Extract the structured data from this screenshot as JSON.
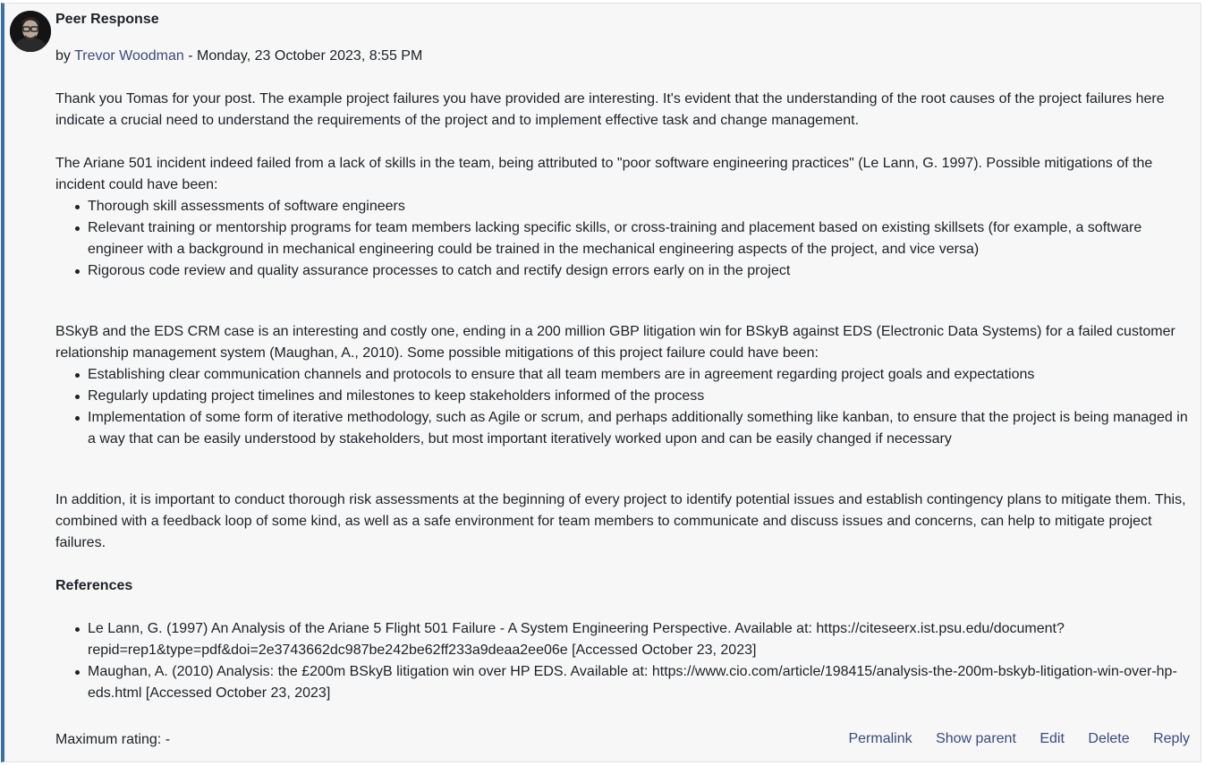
{
  "post": {
    "subject": "Peer Response",
    "byline_prefix": "by ",
    "author": "Trevor Woodman",
    "byline_sep": " - ",
    "date": "Monday, 23 October 2023, 8:55 PM",
    "intro": "Thank you Tomas for your post. The example project failures you have provided are interesting. It's evident that the understanding of the root causes of the project failures here indicate a crucial need to understand the requirements of the project and to implement effective task and change management.",
    "ariane_intro": "The Ariane 501 incident indeed failed from a lack of skills in the team, being attributed to \"poor software engineering practices\" (Le Lann, G. 1997). Possible mitigations of the incident could have been:",
    "ariane_items": [
      "Thorough skill assessments of software engineers",
      "Relevant training or mentorship programs for team members lacking specific skills, or cross-training and placement based on existing skillsets (for example, a software engineer with a background in mechanical engineering could be trained in the mechanical engineering aspects of the project, and vice versa)",
      "Rigorous code review and quality assurance processes to catch and rectify design errors early on in the project"
    ],
    "bskyb_intro": "BSkyB and the EDS CRM case is an interesting and costly one, ending in a 200 million GBP litigation win for BSkyB against EDS (Electronic Data Systems) for a failed customer relationship management system (Maughan, A., 2010). Some possible mitigations of this project failure could have been:",
    "bskyb_items": [
      "Establishing clear communication channels and protocols to ensure that all team members are in agreement regarding project goals and expectations",
      "Regularly updating project timelines and milestones to keep stakeholders informed of the process",
      "Implementation of some form of iterative methodology, such as Agile or scrum, and perhaps additionally something like kanban, to ensure that the project is being managed in a way that can be easily understood by stakeholders, but most important iteratively worked upon and can be easily changed if necessary"
    ],
    "conclusion": "In addition, it is important to conduct thorough risk assessments at the beginning of every project to identify potential issues and establish contingency plans to mitigate them. This, combined with a feedback loop of some kind, as well as a safe environment for team members to communicate and discuss issues and concerns, can help to mitigate project failures.",
    "references_title": "References",
    "references": [
      "Le Lann, G. (1997) An Analysis of the Ariane 5 Flight 501 Failure - A System Engineering Perspective. Available at: https://citeseerx.ist.psu.edu/document?repid=rep1&type=pdf&doi=2e3743662dc987be242be62ff233a9deaa2ee06e [Accessed October 23, 2023]",
      "Maughan, A. (2010) Analysis: the £200m BSkyB litigation win over HP EDS. Available at: https://www.cio.com/article/198415/analysis-the-200m-bskyb-litigation-win-over-hp-eds.html [Accessed October 23, 2023]"
    ]
  },
  "footer": {
    "rating": "Maximum rating: -",
    "actions": [
      "Permalink",
      "Show parent",
      "Edit",
      "Delete",
      "Reply"
    ]
  },
  "icons": {
    "avatar": "user-avatar-photo"
  },
  "colors": {
    "accent_border": "#3f6da8",
    "link": "#3b4a7f",
    "background": "#f7f7f7"
  }
}
